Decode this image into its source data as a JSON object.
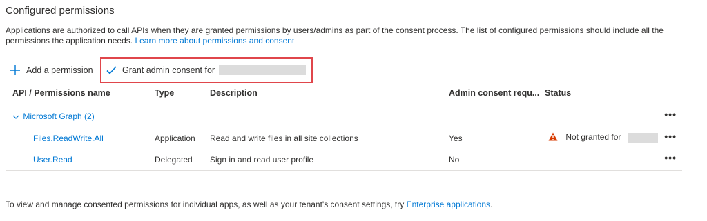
{
  "page": {
    "title": "Configured permissions",
    "description_text": "Applications are authorized to call APIs when they are granted permissions by users/admins as part of the consent process. The list of configured permissions should include all the permissions the application needs.",
    "learn_more": "Learn more about permissions and consent"
  },
  "toolbar": {
    "add_label": "Add a permission",
    "grant_label": "Grant admin consent for"
  },
  "table": {
    "headers": {
      "api": "API / Permissions name",
      "type": "Type",
      "description": "Description",
      "admin": "Admin consent requ...",
      "status": "Status"
    },
    "group": {
      "label": "Microsoft Graph (2)"
    },
    "rows": [
      {
        "name": "Files.ReadWrite.All",
        "type": "Application",
        "description": "Read and write files in all site collections",
        "admin": "Yes",
        "status": "Not granted for"
      },
      {
        "name": "User.Read",
        "type": "Delegated",
        "description": "Sign in and read user profile",
        "admin": "No",
        "status": ""
      }
    ],
    "more_glyph": "•••"
  },
  "footer": {
    "text": "To view and manage consented permissions for individual apps, as well as your tenant's consent settings, try",
    "link": "Enterprise applications",
    "end": "."
  },
  "colors": {
    "link": "#0078d4",
    "highlight_border": "#e0464b",
    "warning": "#d83b01",
    "divider": "#e1dfdd"
  },
  "icons": {
    "add": "plus-icon",
    "grant": "checkmark-icon",
    "group_toggle": "chevron-down-icon",
    "status": "warning-icon",
    "more": "more-icon"
  }
}
